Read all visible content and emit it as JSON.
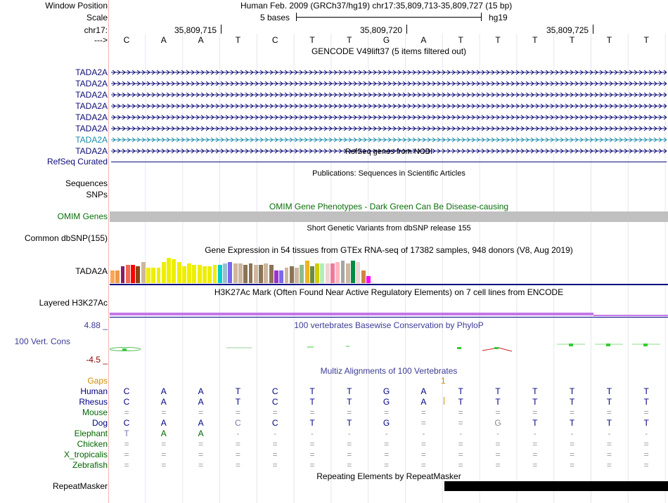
{
  "window_position": {
    "label": "Window Position",
    "value": "Human Feb. 2009 (GRCh37/hg19)   chr17:35,809,713-35,809,727 (15 bp)"
  },
  "scale": {
    "label": "Scale",
    "bases": "5 bases",
    "assembly": "hg19"
  },
  "chrom": {
    "label": "chr17:",
    "ticks": [
      "35,809,715",
      "35,809,720",
      "35,809,725"
    ]
  },
  "strand": {
    "label": "--->",
    "bases": [
      "C",
      "A",
      "A",
      "T",
      "C",
      "T",
      "T",
      "G",
      "A",
      "T",
      "T",
      "T",
      "T",
      "T",
      "T"
    ]
  },
  "gencode": {
    "title": "GENCODE V49lift37 (5 items filtered out)",
    "genes": [
      {
        "name": "TADA2A",
        "color": "#0c0c78"
      },
      {
        "name": "TADA2A",
        "color": "#0c0c78"
      },
      {
        "name": "TADA2A",
        "color": "#0c0c78"
      },
      {
        "name": "TADA2A",
        "color": "#0c0c78"
      },
      {
        "name": "TADA2A",
        "color": "#0c0c78"
      },
      {
        "name": "TADA2A",
        "color": "#0c0c78"
      },
      {
        "name": "TADA2A",
        "color": "#1a8caa"
      },
      {
        "name": "TADA2A",
        "color": "#0c0c78"
      }
    ]
  },
  "refseq": {
    "title": "RefSeq genes from NCBI",
    "label": "RefSeq Curated"
  },
  "publications": {
    "title": "Publications: Sequences in Scientific Articles",
    "label1": "Sequences",
    "label2": "SNPs"
  },
  "omim": {
    "title": "OMIM Gene Phenotypes - Dark Green Can Be Disease-causing",
    "label": "OMIM Genes"
  },
  "dbsnp": {
    "title": "Short Genetic Variants from dbSNP release 155",
    "label": "Common dbSNP(155)"
  },
  "gtex": {
    "title": "Gene Expression in 54 tissues from GTEx RNA-seq of 17382 samples, 948 donors (V8, Aug 2019)",
    "label": "TADA2A",
    "bars": [
      {
        "v": 0.45,
        "c": "#ffa54f"
      },
      {
        "v": 0.45,
        "c": "#ee9a49"
      },
      {
        "v": 0.6,
        "c": "#8b1c62"
      },
      {
        "v": 0.65,
        "c": "#ee6a50"
      },
      {
        "v": 0.65,
        "c": "#ff0000"
      },
      {
        "v": 0.6,
        "c": "#8b4513"
      },
      {
        "v": 0.75,
        "c": "#cdb79e"
      },
      {
        "v": 0.55,
        "c": "#eeee00"
      },
      {
        "v": 0.55,
        "c": "#eeee00"
      },
      {
        "v": 0.55,
        "c": "#eeee00"
      },
      {
        "v": 0.75,
        "c": "#eeee00"
      },
      {
        "v": 0.9,
        "c": "#eeee00"
      },
      {
        "v": 0.85,
        "c": "#eeee00"
      },
      {
        "v": 0.75,
        "c": "#eeee00"
      },
      {
        "v": 0.6,
        "c": "#eeee00"
      },
      {
        "v": 0.7,
        "c": "#eeee00"
      },
      {
        "v": 0.65,
        "c": "#eeee00"
      },
      {
        "v": 0.65,
        "c": "#eeee00"
      },
      {
        "v": 0.6,
        "c": "#eeee00"
      },
      {
        "v": 0.6,
        "c": "#eeee00"
      },
      {
        "v": 0.65,
        "c": "#eeee00"
      },
      {
        "v": 0.65,
        "c": "#00cdcd"
      },
      {
        "v": 0.7,
        "c": "#9ac0cd"
      },
      {
        "v": 0.75,
        "c": "#7a67ee"
      },
      {
        "v": 0.7,
        "c": "#cdb79e"
      },
      {
        "v": 0.7,
        "c": "#cdb79e"
      },
      {
        "v": 0.65,
        "c": "#8b7355"
      },
      {
        "v": 0.7,
        "c": "#8b7355"
      },
      {
        "v": 0.65,
        "c": "#cdb79e"
      },
      {
        "v": 0.65,
        "c": "#8b7355"
      },
      {
        "v": 0.7,
        "c": "#cdb79e"
      },
      {
        "v": 0.65,
        "c": "#8b7355"
      },
      {
        "v": 0.45,
        "c": "#9a32cd"
      },
      {
        "v": 0.45,
        "c": "#7a67ee"
      },
      {
        "v": 0.55,
        "c": "#cdb79e"
      },
      {
        "v": 0.6,
        "c": "#8b7355"
      },
      {
        "v": 0.55,
        "c": "#cdb79e"
      },
      {
        "v": 0.65,
        "c": "#8fbc8f"
      },
      {
        "v": 0.8,
        "c": "#eeb422"
      },
      {
        "v": 0.6,
        "c": "#6e8b3d"
      },
      {
        "v": 0.7,
        "c": "#cdcd00"
      },
      {
        "v": 0.7,
        "c": "#b4eeb4"
      },
      {
        "v": 0.7,
        "c": "#eed5d2"
      },
      {
        "v": 0.7,
        "c": "#ee799f"
      },
      {
        "v": 0.75,
        "c": "#ffb6c1"
      },
      {
        "v": 0.8,
        "c": "#a6a6a6"
      },
      {
        "v": 0.7,
        "c": "#cdb79e"
      },
      {
        "v": 0.8,
        "c": "#008b45"
      },
      {
        "v": 0.75,
        "c": "#eed5d2"
      },
      {
        "v": 0.45,
        "c": "#cd853f"
      },
      {
        "v": 0.25,
        "c": "#ff00ff"
      }
    ]
  },
  "h3k27ac": {
    "title": "H3K27Ac Mark (Often Found Near Active Regulatory Elements) on 7 cell lines from ENCODE",
    "label": "Layered H3K27Ac"
  },
  "phylop": {
    "title": "100 vertebrates Basewise Conservation by PhyloP",
    "label": "100 Vert. Cons",
    "max": "4.88 _",
    "min": "-4.5 _"
  },
  "multiz": {
    "title": "Multiz Alignments of 100 Vertebrates",
    "gaps_label": "Gaps",
    "gap_count": "1",
    "species": [
      {
        "name": "Human",
        "color": "#000080",
        "bases": [
          "C",
          "A",
          "A",
          "T",
          "C",
          "T",
          "T",
          "G",
          "A",
          "T",
          "T",
          "T",
          "T",
          "T",
          "T"
        ]
      },
      {
        "name": "Rhesus",
        "color": "#000080",
        "bases": [
          "C",
          "A",
          "A",
          "T",
          "C",
          "T",
          "T",
          "G",
          "A",
          "T",
          "T",
          "T",
          "T",
          "T",
          "T"
        ]
      },
      {
        "name": "Mouse",
        "color": "#006400",
        "bases": [
          "=",
          "=",
          "=",
          "=",
          "=",
          "=",
          "=",
          "=",
          "=",
          "=",
          "=",
          "=",
          "=",
          "=",
          "="
        ]
      },
      {
        "name": "Dog",
        "color": "#000080",
        "bases": [
          "C",
          "A",
          "A",
          "C",
          "C",
          "T",
          "T",
          "G",
          "=",
          "=",
          "G",
          "T",
          "T",
          "T",
          "T"
        ]
      },
      {
        "name": "Elephant",
        "color": "#006400",
        "bases": [
          "T",
          "A",
          "A",
          "-",
          "-",
          "-",
          "-",
          "-",
          "-",
          "-",
          "-",
          "-",
          "-",
          "-",
          "-"
        ]
      },
      {
        "name": "Chicken",
        "color": "#006400",
        "bases": [
          "=",
          "=",
          "=",
          "=",
          "=",
          "=",
          "=",
          "=",
          "=",
          "=",
          "=",
          "=",
          "=",
          "=",
          "="
        ]
      },
      {
        "name": "X_tropicalis",
        "color": "#006400",
        "bases": [
          "=",
          "=",
          "=",
          "=",
          "=",
          "=",
          "=",
          "=",
          "=",
          "=",
          "=",
          "=",
          "=",
          "=",
          "="
        ]
      },
      {
        "name": "Zebrafish",
        "color": "#006400",
        "bases": [
          "=",
          "=",
          "=",
          "=",
          "=",
          "=",
          "=",
          "=",
          "=",
          "=",
          "=",
          "=",
          "=",
          "=",
          "="
        ]
      }
    ]
  },
  "repeatmasker": {
    "title": "Repeating Elements by RepeatMasker",
    "label": "RepeatMasker"
  }
}
